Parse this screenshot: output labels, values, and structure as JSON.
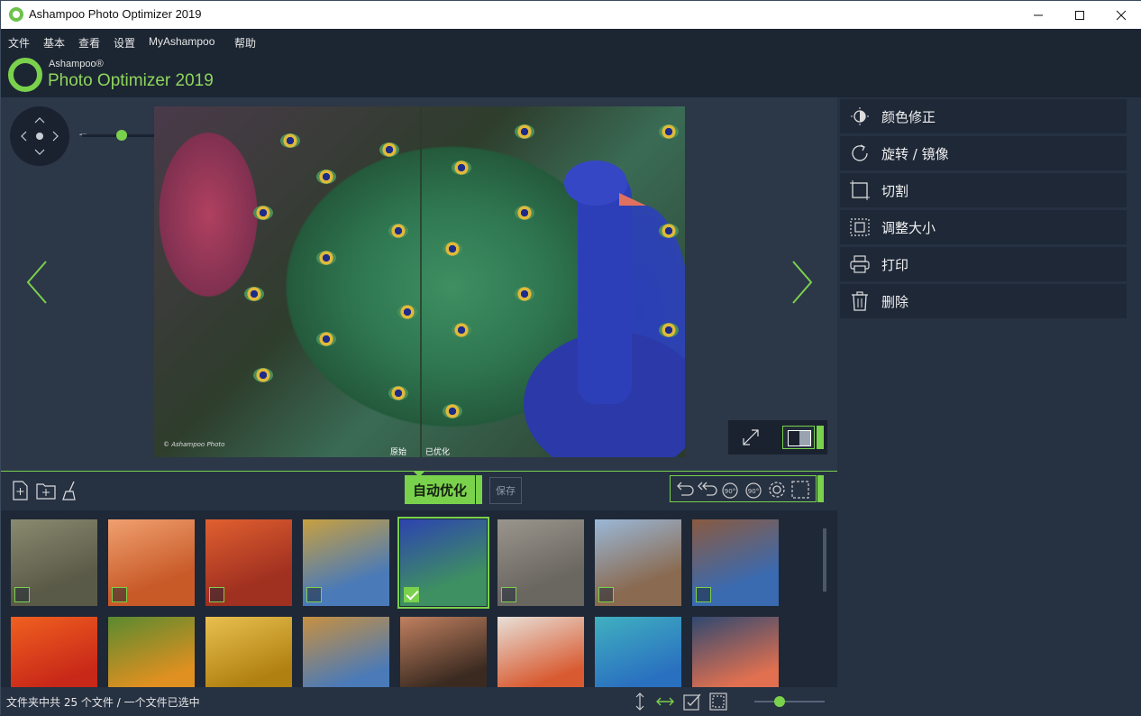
{
  "window": {
    "title": "Ashampoo Photo Optimizer 2019",
    "controls": [
      "minimize",
      "maximize",
      "close"
    ]
  },
  "menu": {
    "items": [
      "文件",
      "基本",
      "查看",
      "设置",
      "MyAshampoo",
      "帮助"
    ]
  },
  "brand": {
    "vendor": "Ashampoo®",
    "product": "Photo Optimizer 2019",
    "accent": "#7ad14c"
  },
  "viewer": {
    "label_original": "原始",
    "label_optimized": "已优化",
    "photo_credit": "© Ashampoo Photo"
  },
  "right_panel": {
    "items": [
      {
        "label": "颜色修正",
        "icon": "color-correction-icon"
      },
      {
        "label": "旋转 / 镜像",
        "icon": "rotate-icon"
      },
      {
        "label": "切割",
        "icon": "crop-icon"
      },
      {
        "label": "调整大小",
        "icon": "resize-icon"
      },
      {
        "label": "打印",
        "icon": "print-icon"
      },
      {
        "label": "删除",
        "icon": "trash-icon"
      }
    ]
  },
  "toolbar": {
    "auto_optimize": "自动优化",
    "save": "保存"
  },
  "gallery": {
    "row1": [
      {
        "name": "temple-ruins",
        "checked": false,
        "selected": false,
        "colors": [
          "#5a5a48",
          "#8a8a70"
        ]
      },
      {
        "name": "antelope-canyon",
        "checked": false,
        "selected": false,
        "colors": [
          "#c85a28",
          "#f0a070"
        ]
      },
      {
        "name": "red-plant",
        "checked": false,
        "selected": false,
        "colors": [
          "#a03020",
          "#e06030"
        ]
      },
      {
        "name": "golden-stupa",
        "checked": false,
        "selected": false,
        "colors": [
          "#4a7ab8",
          "#c8a040"
        ]
      },
      {
        "name": "peacock",
        "checked": true,
        "selected": true,
        "colors": [
          "#3e8f62",
          "#2d43b0"
        ]
      },
      {
        "name": "stone-face",
        "checked": false,
        "selected": false,
        "colors": [
          "#6a6660",
          "#9a958c"
        ]
      },
      {
        "name": "bird-tree",
        "checked": false,
        "selected": false,
        "colors": [
          "#8a6a50",
          "#9ab8d8"
        ]
      },
      {
        "name": "wooden-church",
        "checked": false,
        "selected": false,
        "colors": [
          "#3a6ab0",
          "#8a5a40"
        ]
      }
    ],
    "row2": [
      {
        "name": "red-leaves",
        "colors": [
          "#c82818",
          "#f06020"
        ]
      },
      {
        "name": "marigolds",
        "colors": [
          "#e09020",
          "#5a8a30"
        ]
      },
      {
        "name": "golden-statue",
        "colors": [
          "#b08010",
          "#e8c050"
        ]
      },
      {
        "name": "thai-temple",
        "colors": [
          "#4a7ab8",
          "#c89040"
        ]
      },
      {
        "name": "smiling-woman",
        "colors": [
          "#3a2a20",
          "#c08060"
        ]
      },
      {
        "name": "old-man-turban",
        "colors": [
          "#d85a30",
          "#e8e0d8"
        ]
      },
      {
        "name": "tropical-beach",
        "colors": [
          "#2a70c0",
          "#40b0c0"
        ]
      },
      {
        "name": "sunset-boat",
        "colors": [
          "#e07050",
          "#304870"
        ]
      }
    ]
  },
  "status": {
    "text": "文件夹中共 25 个文件 / 一个文件已选中"
  }
}
